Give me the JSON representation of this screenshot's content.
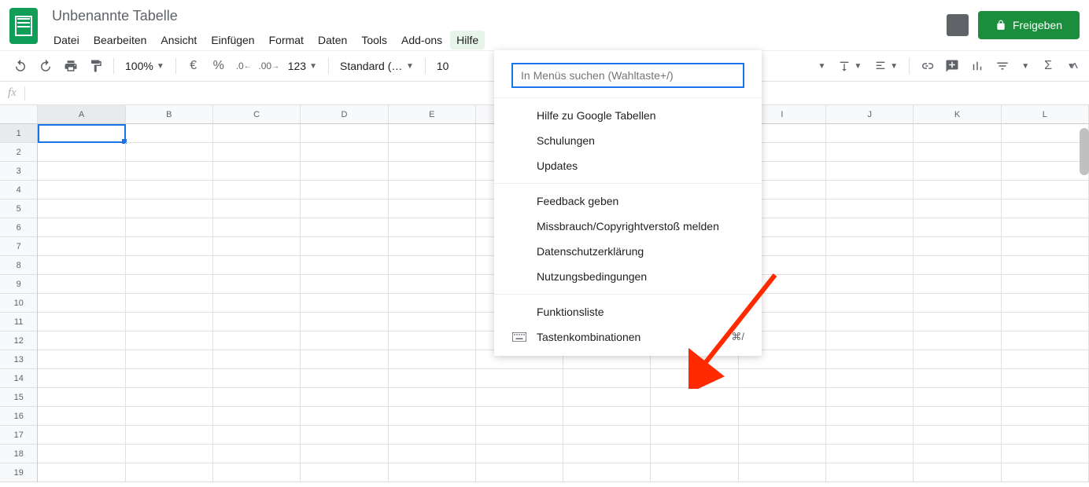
{
  "doc_title": "Unbenannte Tabelle",
  "menus": [
    "Datei",
    "Bearbeiten",
    "Ansicht",
    "Einfügen",
    "Format",
    "Daten",
    "Tools",
    "Add-ons",
    "Hilfe"
  ],
  "active_menu_index": 8,
  "share_label": "Freigeben",
  "toolbar": {
    "zoom": "100%",
    "currency": "€",
    "percent": "%",
    "dec_less": ".0",
    "dec_more": ".00",
    "num_fmt": "123",
    "font": "Standard (…",
    "font_size": "10"
  },
  "fx": "fx",
  "columns": [
    "A",
    "B",
    "C",
    "D",
    "E",
    "",
    "",
    "",
    "I",
    "J",
    "K",
    "L"
  ],
  "selected_col": 0,
  "rows": 19,
  "selected_row": 1,
  "help_menu": {
    "search_placeholder": "In Menüs suchen (Wahltaste+/)",
    "group1": [
      "Hilfe zu Google Tabellen",
      "Schulungen",
      "Updates"
    ],
    "group2": [
      "Feedback geben",
      "Missbrauch/Copyrightverstoß melden",
      "Datenschutzerklärung",
      "Nutzungsbedingungen"
    ],
    "group3": [
      {
        "label": "Funktionsliste",
        "icon": "",
        "shortcut": ""
      },
      {
        "label": "Tastenkombinationen",
        "icon": "keyboard",
        "shortcut": "⌘/"
      }
    ]
  }
}
